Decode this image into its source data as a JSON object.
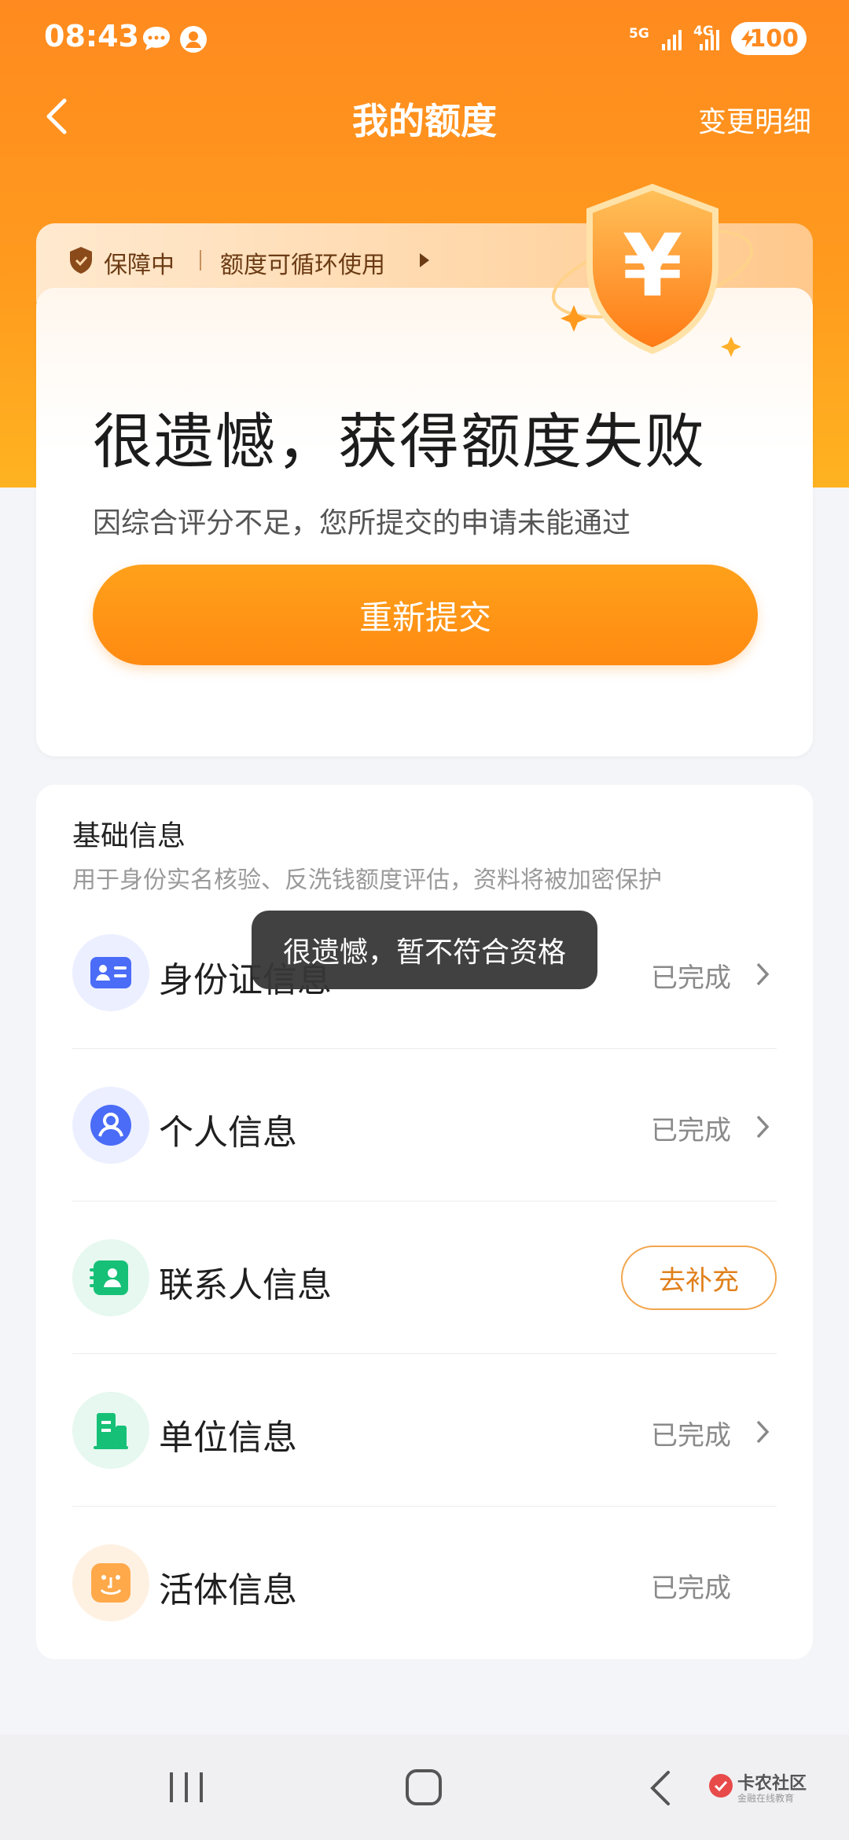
{
  "status_bar": {
    "time": "08:43",
    "network1": "5G",
    "network2": "4G",
    "battery": "100"
  },
  "header": {
    "title": "我的额度",
    "right_link": "变更明细"
  },
  "guarantee": {
    "status": "保障中",
    "recycle": "额度可循环使用"
  },
  "result": {
    "title": "很遗憾，获得额度失败",
    "subtitle": "因综合评分不足，您所提交的申请未能通过",
    "button": "重新提交"
  },
  "info": {
    "title": "基础信息",
    "subtitle": "用于身份实名核验、反洗钱额度评估，资料将被加密保护",
    "rows": [
      {
        "label": "身份证信息",
        "status": "已完成",
        "icon": "id-card-icon"
      },
      {
        "label": "个人信息",
        "status": "已完成",
        "icon": "person-icon"
      },
      {
        "label": "联系人信息",
        "action": "去补充",
        "icon": "contact-icon"
      },
      {
        "label": "单位信息",
        "status": "已完成",
        "icon": "building-icon"
      },
      {
        "label": "活体信息",
        "status": "已完成",
        "icon": "face-icon"
      }
    ]
  },
  "toast": "很遗憾，暂不符合资格",
  "watermark": {
    "name": "卡农社区",
    "sub": "金融在线教育"
  },
  "colors": {
    "brand_orange": "#ff8a1f",
    "button_orange": "#ff9316"
  }
}
